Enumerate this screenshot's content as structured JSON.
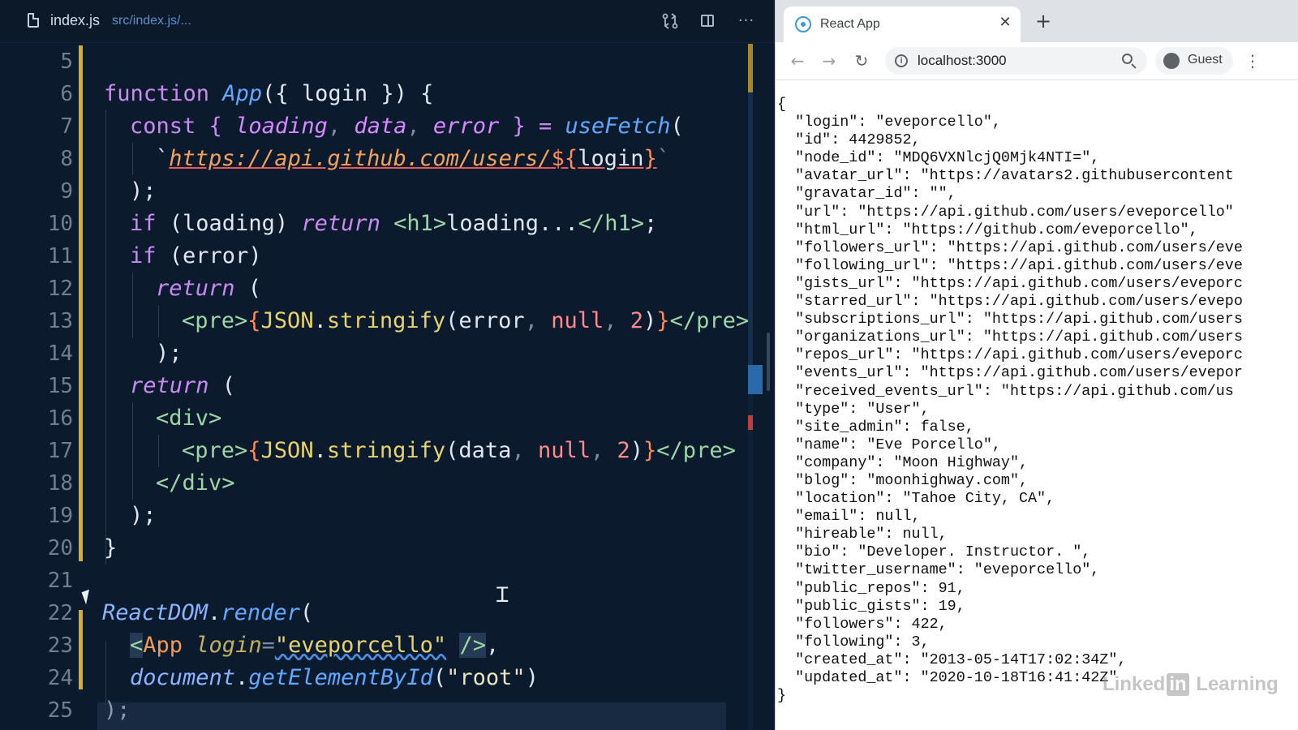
{
  "editor": {
    "filename": "index.js",
    "path": "src/index.js/...",
    "more_label": "···"
  },
  "browser": {
    "tab_title": "React App",
    "tab_close": "✕",
    "new_tab": "+",
    "url": "localhost:3000",
    "profile": "Guest",
    "back": "←",
    "forward": "→",
    "reload": "↻",
    "menu": "⋮",
    "json_lines": [
      "{",
      "  \"login\": \"eveporcello\",",
      "  \"id\": 4429852,",
      "  \"node_id\": \"MDQ6VXNlcjQ0Mjk4NTI=\",",
      "  \"avatar_url\": \"https://avatars2.githubusercontent",
      "  \"gravatar_id\": \"\",",
      "  \"url\": \"https://api.github.com/users/eveporcello\"",
      "  \"html_url\": \"https://github.com/eveporcello\",",
      "  \"followers_url\": \"https://api.github.com/users/eve",
      "  \"following_url\": \"https://api.github.com/users/eve",
      "  \"gists_url\": \"https://api.github.com/users/eveporc",
      "  \"starred_url\": \"https://api.github.com/users/evepo",
      "  \"subscriptions_url\": \"https://api.github.com/users",
      "  \"organizations_url\": \"https://api.github.com/users",
      "  \"repos_url\": \"https://api.github.com/users/eveporc",
      "  \"events_url\": \"https://api.github.com/users/evepor",
      "  \"received_events_url\": \"https://api.github.com/us",
      "  \"type\": \"User\",",
      "  \"site_admin\": false,",
      "  \"name\": \"Eve Porcello\",",
      "  \"company\": \"Moon Highway\",",
      "  \"blog\": \"moonhighway.com\",",
      "  \"location\": \"Tahoe City, CA\",",
      "  \"email\": null,",
      "  \"hireable\": null,",
      "  \"bio\": \"Developer. Instructor. \",",
      "  \"twitter_username\": \"eveporcello\",",
      "  \"public_repos\": 91,",
      "  \"public_gists\": 19,",
      "  \"followers\": 422,",
      "  \"following\": 3,",
      "  \"created_at\": \"2013-05-14T17:02:34Z\",",
      "  \"updated_at\": \"2020-10-18T16:41:42Z\"",
      "}"
    ]
  },
  "code": {
    "line_numbers": [
      "5",
      "6",
      "7",
      "8",
      "9",
      "10",
      "11",
      "12",
      "13",
      "14",
      "15",
      "16",
      "17",
      "18",
      "19",
      "20",
      "21",
      "22",
      "23",
      "24",
      "25"
    ],
    "l6": {
      "kw": "function ",
      "fn": "App",
      "rest": "({ login }) {"
    },
    "l7": {
      "kw": "const ",
      "p1": "{ ",
      "v1": "loading",
      "c1": ", ",
      "v2": "data",
      "c2": ", ",
      "v3": "error",
      "p2": " } = ",
      "fn": "useFetch",
      "p3": "("
    },
    "l8": {
      "tick": "`",
      "url": "https://api.github.com/users/",
      "d1": "${",
      "var": "login",
      "d2": "}",
      "tick2": "`"
    },
    "l9": {
      "text": ");"
    },
    "l10": {
      "kw": "if ",
      "p1": "(loading) ",
      "ret": "return ",
      "t1": "<h1>",
      "txt": "loading...",
      "t2": "</h1>",
      "end": ";"
    },
    "l11": {
      "kw": "if ",
      "p1": "(error)"
    },
    "l12": {
      "ret": "return ",
      "p1": "("
    },
    "l13": {
      "t1": "<pre>",
      "b1": "{",
      "obj": "JSON",
      "dot": ".",
      "m": "stringify",
      "p1": "(error",
      "c1": ", ",
      "n": "null",
      "c2": ", ",
      "num": "2",
      "p2": ")",
      "b2": "}",
      "t2": "</pre>"
    },
    "l14": {
      "text": ");"
    },
    "l15": {
      "ret": "return ",
      "p1": "("
    },
    "l16": {
      "t": "<div>"
    },
    "l17": {
      "t1": "<pre>",
      "b1": "{",
      "obj": "JSON",
      "dot": ".",
      "m": "stringify",
      "p1": "(data",
      "c1": ", ",
      "n": "null",
      "c2": ", ",
      "num": "2",
      "p2": ")",
      "b2": "}",
      "t2": "</pre>"
    },
    "l18": {
      "t": "</div>"
    },
    "l19": {
      "text": ");"
    },
    "l20": {
      "text": "}"
    },
    "l22": {
      "obj": "ReactDOM",
      "dot": ".",
      "m": "render",
      "p": "("
    },
    "l23": {
      "lt": "<",
      "comp": "App ",
      "attr": "login",
      "eq": "=",
      "val": "\"eveporcello\"",
      "sp": " ",
      "end": "/>",
      "comma": ","
    },
    "l24": {
      "obj": "document",
      "dot": ".",
      "m": "getElementById",
      "p1": "(",
      "s": "\"root\"",
      "p2": ")"
    },
    "l25": {
      "text": ");"
    }
  },
  "watermark": {
    "pre": "Linked",
    "in": "in",
    "post": " Learning"
  }
}
